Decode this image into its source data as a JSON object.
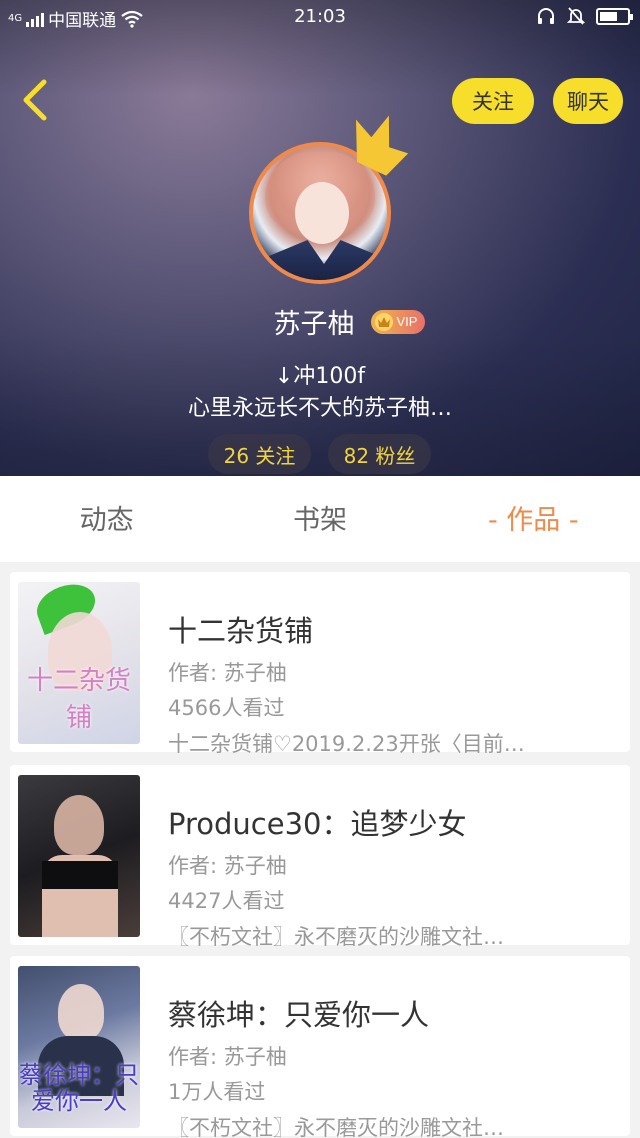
{
  "status_bar": {
    "network": "4G",
    "carrier": "中国联通",
    "time": "21:03"
  },
  "header": {
    "follow_label": "关注",
    "chat_label": "聊天",
    "username": "苏子柚",
    "vip_label": "VIP",
    "bio_line1": "↓冲100f",
    "bio_line2": "心里永远长不大的苏子柚…",
    "following_stat": "26 关注",
    "fans_stat": "82 粉丝"
  },
  "tabs": [
    {
      "label": "动态",
      "active": false
    },
    {
      "label": "书架",
      "active": false
    },
    {
      "label": "- 作品 -",
      "active": true
    }
  ],
  "works": [
    {
      "title": "十二杂货铺",
      "author": "作者: 苏子柚",
      "views": "4566人看过",
      "desc": "十二杂货铺♡2019.2.23开张〈目前…",
      "cover_text": "十二杂货铺"
    },
    {
      "title": "Produce30：追梦少女",
      "author": "作者: 苏子柚",
      "views": "4427人看过",
      "desc": "〖不朽文社〗永不磨灭的沙雕文社…",
      "cover_text": ""
    },
    {
      "title": "蔡徐坤：只爱你一人",
      "author": "作者: 苏子柚",
      "views": "1万人看过",
      "desc": "〖不朽文社〗永不磨灭的沙雕文社…",
      "cover_text": "蔡徐坤：只爱你一人"
    }
  ],
  "colors": {
    "accent": "#f08a4b",
    "button_yellow": "#f6de2a",
    "stat_text": "#f2d43c"
  }
}
